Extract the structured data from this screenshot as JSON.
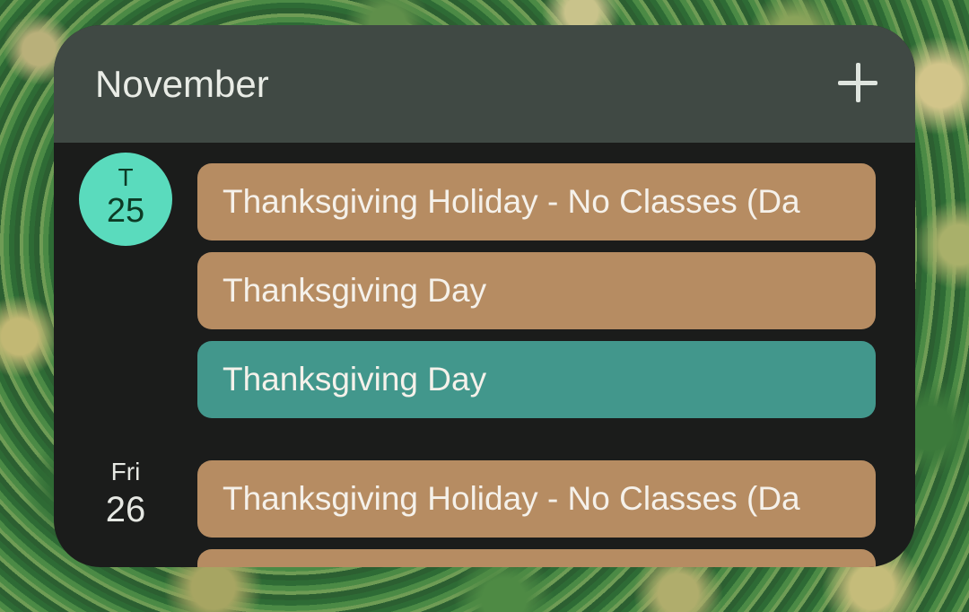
{
  "widget": {
    "month": "November",
    "add_icon": "plus-icon"
  },
  "days": [
    {
      "dow": "T",
      "day": "25",
      "events": [
        {
          "title": "Thanksgiving Holiday - No Classes (Da",
          "color": "#b68c62"
        },
        {
          "title": "Thanksgiving Day",
          "color": "#b68c62"
        },
        {
          "title": "Thanksgiving Day",
          "color": "#42978c"
        }
      ]
    },
    {
      "dow": "Fri",
      "day": "26",
      "events": [
        {
          "title": "Thanksgiving Holiday - No Classes (Da",
          "color": "#b68c62"
        },
        {
          "title": "",
          "color": "#b68c62"
        }
      ]
    }
  ],
  "colors": {
    "header_bg": "#404944",
    "body_bg": "#1b1c1b",
    "today_badge": "#5adbbd"
  }
}
